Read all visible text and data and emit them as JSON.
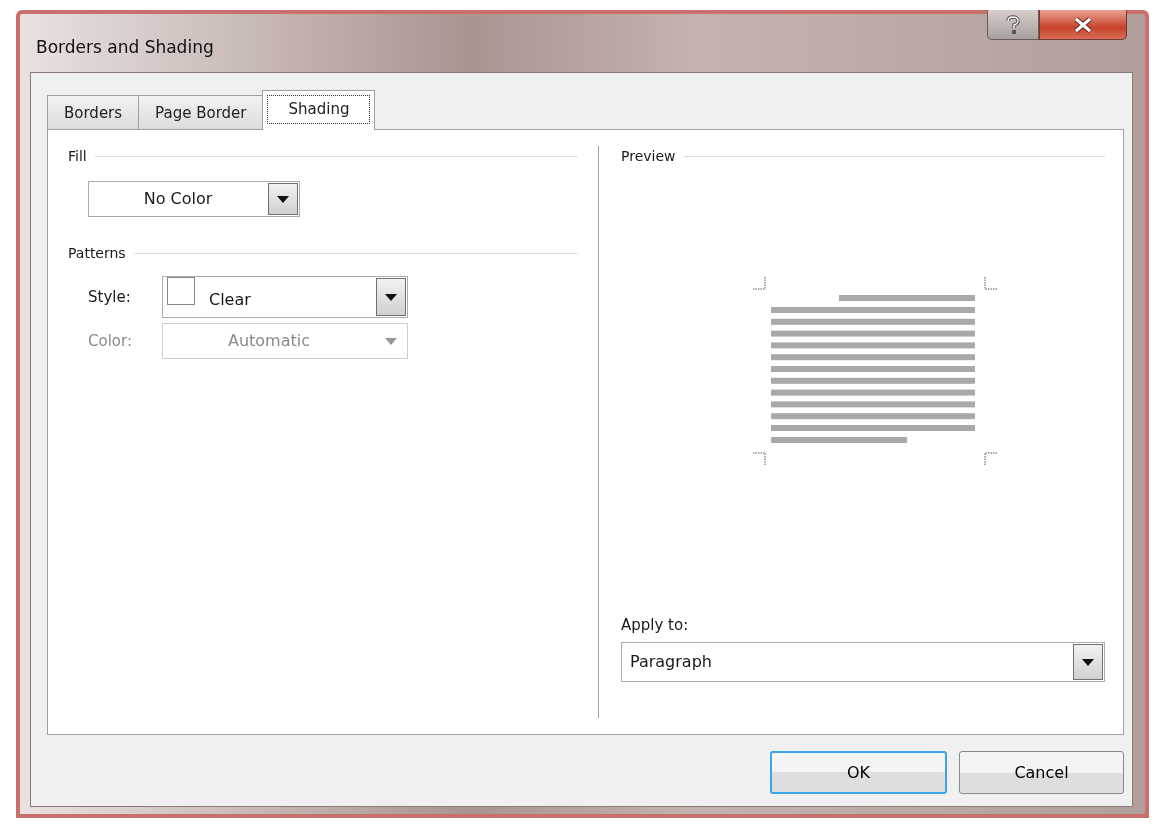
{
  "window": {
    "title": "Borders and Shading"
  },
  "tabs": [
    {
      "label": "Borders",
      "selected": false
    },
    {
      "label": "Page Border",
      "selected": false
    },
    {
      "label": "Shading",
      "selected": true
    }
  ],
  "fill": {
    "heading": "Fill",
    "value": "No Color"
  },
  "patterns": {
    "heading": "Patterns",
    "fields": [
      {
        "label": "Style:",
        "value": "Clear",
        "kind": "swatch",
        "disabled": false
      },
      {
        "label": "Color:",
        "value": "Automatic",
        "kind": "plain",
        "disabled": true
      }
    ]
  },
  "preview": {
    "heading": "Preview"
  },
  "apply_to": {
    "label": "Apply to:",
    "value": "Paragraph"
  },
  "buttons": [
    {
      "label": "OK",
      "default": true
    },
    {
      "label": "Cancel",
      "default": false
    }
  ]
}
